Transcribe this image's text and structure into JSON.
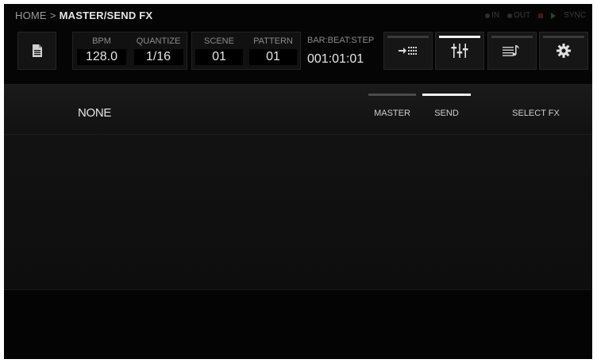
{
  "breadcrumb": {
    "home": "HOME",
    "separator": ">",
    "current": "MASTER/SEND FX"
  },
  "status": {
    "midi_in": "IN",
    "midi_out": "OUT",
    "sync": "SYNC"
  },
  "toolbar": {
    "bpm": {
      "label": "BPM",
      "value": "128.0"
    },
    "quantize": {
      "label": "QUANTIZE",
      "value": "1/16"
    },
    "scene": {
      "label": "SCENE",
      "value": "01"
    },
    "pattern": {
      "label": "PATTERN",
      "value": "01"
    },
    "position": {
      "label": "BAR:BEAT:STEP",
      "value": "001:01:01"
    }
  },
  "modes": [
    {
      "icon": "sequencer-icon",
      "active": false
    },
    {
      "icon": "mixer-icon",
      "active": true
    },
    {
      "icon": "piano-roll-icon",
      "active": false
    },
    {
      "icon": "settings-gear-icon",
      "active": false
    }
  ],
  "fx_panel": {
    "current_fx": "NONE",
    "tabs": [
      {
        "label": "MASTER",
        "active": false
      },
      {
        "label": "SEND",
        "active": true
      }
    ],
    "select_fx": "SELECT FX"
  },
  "colors": {
    "background": "#050505",
    "panel": "#141414",
    "active_indicator": "#f2f2f2",
    "text": "#e6e6e6",
    "label": "#8c8c8c"
  }
}
